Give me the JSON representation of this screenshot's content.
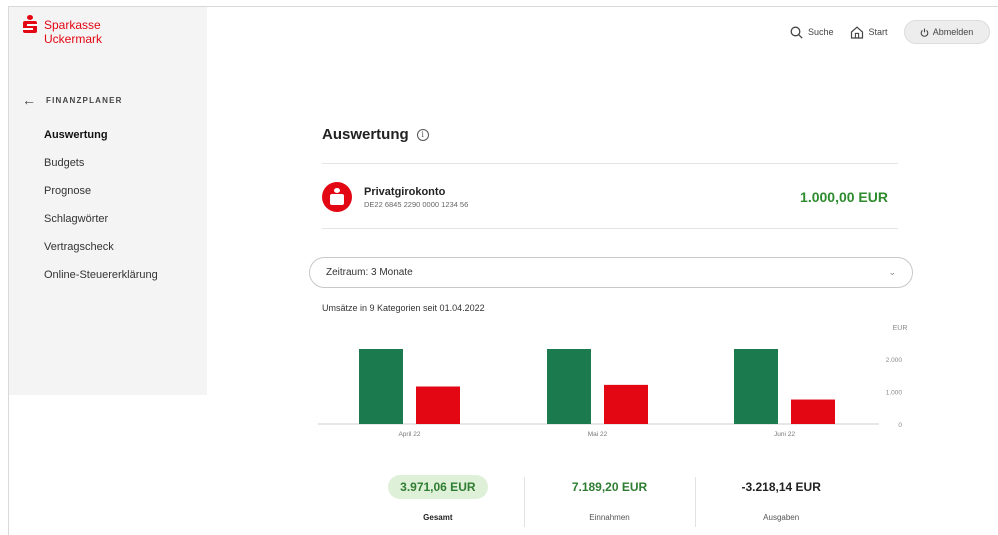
{
  "brand": {
    "line1": "Sparkasse",
    "line2": "Uckermark"
  },
  "topbar": {
    "search_label": "Suche",
    "start_label": "Start",
    "logout_label": "Abmelden"
  },
  "sidebar": {
    "back_icon": "arrow-left-icon",
    "section_title": "FINANZPLANER",
    "items": [
      {
        "label": "Auswertung",
        "active": true
      },
      {
        "label": "Budgets"
      },
      {
        "label": "Prognose"
      },
      {
        "label": "Schlagwörter"
      },
      {
        "label": "Vertragscheck"
      },
      {
        "label": "Online-Steuererklärung"
      }
    ]
  },
  "main": {
    "title": "Auswertung",
    "account": {
      "name": "Privatgirokonto",
      "iban": "DE22 6845 2290 0000 1234 56",
      "balance": "1.000,00 EUR"
    },
    "period_label": "Zeitraum: 3 Monate",
    "chart_caption": "Umsätze in 9 Kategorien seit 01.04.2022",
    "summary": {
      "total_value": "3.971,06 EUR",
      "total_label": "Gesamt",
      "income_value": "7.189,20 EUR",
      "income_label": "Einnahmen",
      "expense_value": "-3.218,14 EUR",
      "expense_label": "Ausgaben"
    }
  },
  "colors": {
    "brand_red": "#e30613",
    "income_green": "#1b7a4e",
    "expense_red": "#e30613",
    "positive_text": "#2e8b2e"
  },
  "chart_data": {
    "type": "bar",
    "categories": [
      "April 22",
      "Mai 22",
      "Juni 22"
    ],
    "series": [
      {
        "values": [
          2300,
          2300,
          2300
        ],
        "color": "#1b7a4e"
      },
      {
        "values": [
          1150,
          1200,
          750
        ],
        "color": "#e30613"
      }
    ],
    "ylabel": "EUR",
    "yticks": [
      "2.000",
      "1.000",
      "0"
    ],
    "ylim": [
      0,
      3000
    ],
    "grid": false
  }
}
